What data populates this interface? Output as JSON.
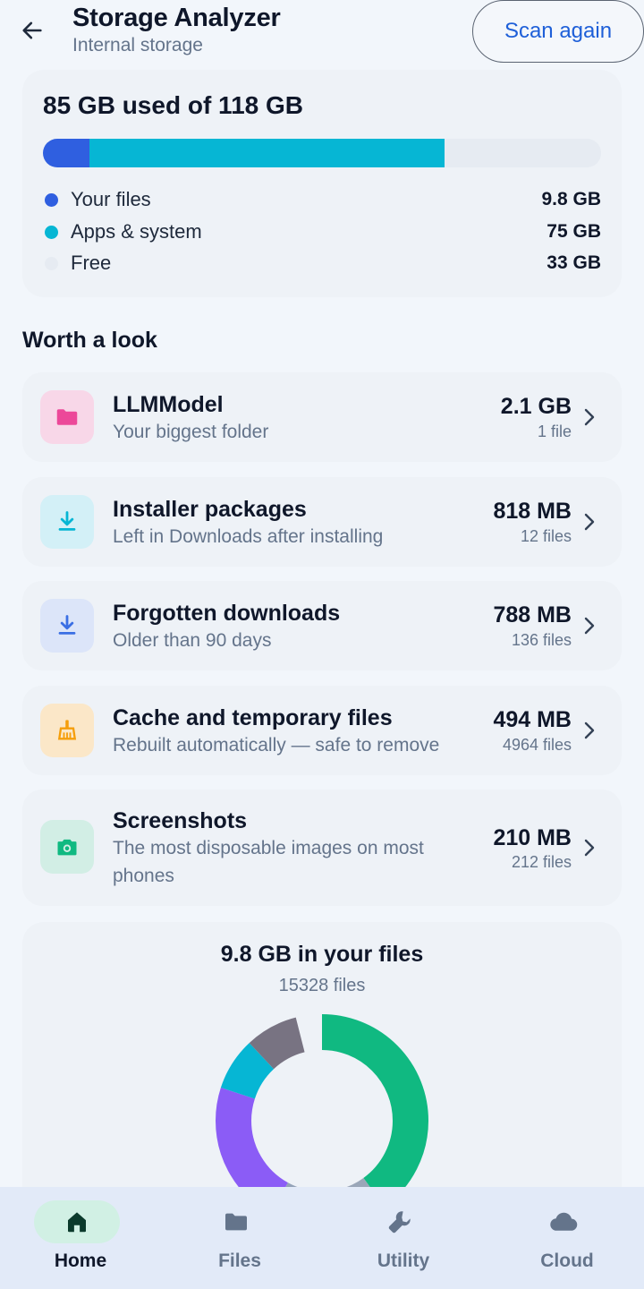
{
  "header": {
    "title": "Storage Analyzer",
    "subtitle": "Internal storage",
    "scan_button": "Scan again",
    "back_icon": "arrow-left-icon"
  },
  "storage": {
    "title": "85 GB used of 118 GB",
    "bar": [
      {
        "name": "Your files",
        "fraction": 0.083,
        "color": "#2f5fe0"
      },
      {
        "name": "Apps & system",
        "fraction": 0.636,
        "color": "#06b6d4"
      },
      {
        "name": "Free",
        "fraction": 0.281,
        "color": "#e6ebf2"
      }
    ],
    "legend": [
      {
        "label": "Your files",
        "value": "9.8 GB",
        "color": "#2f5fe0"
      },
      {
        "label": "Apps & system",
        "value": "75 GB",
        "color": "#06b6d4"
      },
      {
        "label": "Free",
        "value": "33 GB",
        "color": "#e6ebf2"
      }
    ]
  },
  "section": {
    "heading": "Worth a look"
  },
  "items": [
    {
      "title": "LLMModel",
      "desc": "Your biggest folder",
      "size": "2.1 GB",
      "count": "1 file",
      "icon": "folder-icon",
      "icon_bg": "#f8d7e8",
      "icon_color": "#ec4899"
    },
    {
      "title": "Installer packages",
      "desc": "Left in Downloads after installing",
      "size": "818 MB",
      "count": "12 files",
      "icon": "download-icon",
      "icon_bg": "#d3f0f7",
      "icon_color": "#06b6d4"
    },
    {
      "title": "Forgotten downloads",
      "desc": "Older than 90 days",
      "size": "788 MB",
      "count": "136 files",
      "icon": "download-icon",
      "icon_bg": "#dce5f9",
      "icon_color": "#3b6fe4"
    },
    {
      "title": "Cache and temporary files",
      "desc": "Rebuilt automatically — safe to remove",
      "size": "494 MB",
      "count": "4964 files",
      "icon": "broom-icon",
      "icon_bg": "#fbe7c8",
      "icon_color": "#f59e0b"
    },
    {
      "title": "Screenshots",
      "desc": "The most disposable images on most phones",
      "size": "210 MB",
      "count": "212 files",
      "icon": "camera-icon",
      "icon_bg": "#d2eee5",
      "icon_color": "#10b981"
    }
  ],
  "files": {
    "title": "9.8 GB in your files",
    "subtitle": "15328 files",
    "donut": [
      {
        "fraction": 0.4,
        "color": "#10b981"
      },
      {
        "fraction": 0.06,
        "color": "#9aa6b8"
      },
      {
        "fraction": 0.12,
        "color": "#94a3b8"
      },
      {
        "fraction": 0.22,
        "color": "#8b5cf6"
      },
      {
        "fraction": 0.08,
        "color": "#06b6d4"
      },
      {
        "fraction": 0.08,
        "color": "#787382"
      }
    ]
  },
  "nav": [
    {
      "label": "Home",
      "icon": "home-icon",
      "active": true
    },
    {
      "label": "Files",
      "icon": "folder-icon",
      "active": false
    },
    {
      "label": "Utility",
      "icon": "wrench-icon",
      "active": false
    },
    {
      "label": "Cloud",
      "icon": "cloud-icon",
      "active": false
    }
  ],
  "colors": {
    "accent": "#1e5fd8",
    "nav_active": "#0b3a2c",
    "nav_inactive": "#64748b",
    "nav_pill": "#d1f0e4"
  }
}
